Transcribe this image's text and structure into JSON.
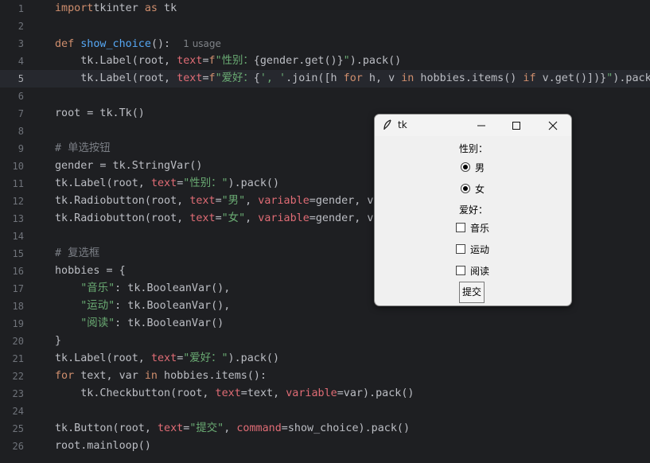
{
  "editor": {
    "current_line": 5,
    "lines": [
      {
        "n": "1",
        "tokens": [
          [
            "kw",
            "import"
          ],
          [
            "",
            "tkinter "
          ],
          [
            "kw",
            "as"
          ],
          [
            "",
            " tk"
          ]
        ]
      },
      {
        "n": "2",
        "tokens": []
      },
      {
        "n": "3",
        "tokens": [
          [
            "kw",
            "def "
          ],
          [
            "fn",
            "show_choice"
          ],
          [
            "",
            "():  "
          ],
          [
            "hint",
            "1 usage"
          ]
        ]
      },
      {
        "n": "4",
        "tokens": [
          [
            "",
            "    tk.Label(root, "
          ],
          [
            "kwa",
            "text"
          ],
          [
            "",
            "="
          ],
          [
            "kw",
            "f"
          ],
          [
            "str",
            "\"性别："
          ],
          [
            "",
            "{gender.get()}"
          ],
          [
            "str",
            "\""
          ],
          [
            "",
            ").pack()"
          ]
        ]
      },
      {
        "n": "5",
        "tokens": [
          [
            "",
            "    tk.Label(root, "
          ],
          [
            "kwa",
            "text"
          ],
          [
            "",
            "="
          ],
          [
            "kw",
            "f"
          ],
          [
            "str",
            "\"爱好："
          ],
          [
            "",
            "{"
          ],
          [
            "str",
            "', '"
          ],
          [
            "",
            ".join([h "
          ],
          [
            "kw",
            "for"
          ],
          [
            "",
            " h, v "
          ],
          [
            "kw",
            "in"
          ],
          [
            "",
            " hobbies.items() "
          ],
          [
            "kw",
            "if"
          ],
          [
            "",
            " v.get()])}"
          ],
          [
            "str",
            "\""
          ],
          [
            "",
            ").pack("
          ]
        ]
      },
      {
        "n": "6",
        "tokens": []
      },
      {
        "n": "7",
        "tokens": [
          [
            "",
            "root = tk.Tk()"
          ]
        ]
      },
      {
        "n": "8",
        "tokens": []
      },
      {
        "n": "9",
        "tokens": [
          [
            "cmt",
            "# 单选按钮"
          ]
        ]
      },
      {
        "n": "10",
        "tokens": [
          [
            "",
            "gender = tk.StringVar()"
          ]
        ]
      },
      {
        "n": "11",
        "tokens": [
          [
            "",
            "tk.Label(root, "
          ],
          [
            "kwa",
            "text"
          ],
          [
            "",
            "="
          ],
          [
            "str",
            "\"性别：\""
          ],
          [
            "",
            ").pack()"
          ]
        ]
      },
      {
        "n": "12",
        "tokens": [
          [
            "",
            "tk.Radiobutton(root, "
          ],
          [
            "kwa",
            "text"
          ],
          [
            "",
            "="
          ],
          [
            "str",
            "\"男\""
          ],
          [
            "",
            ", "
          ],
          [
            "kwa",
            "variable"
          ],
          [
            "",
            "=gender, va"
          ]
        ]
      },
      {
        "n": "13",
        "tokens": [
          [
            "",
            "tk.Radiobutton(root, "
          ],
          [
            "kwa",
            "text"
          ],
          [
            "",
            "="
          ],
          [
            "str",
            "\"女\""
          ],
          [
            "",
            ", "
          ],
          [
            "kwa",
            "variable"
          ],
          [
            "",
            "=gender, va"
          ]
        ]
      },
      {
        "n": "14",
        "tokens": []
      },
      {
        "n": "15",
        "tokens": [
          [
            "cmt",
            "# 复选框"
          ]
        ]
      },
      {
        "n": "16",
        "tokens": [
          [
            "",
            "hobbies = {"
          ]
        ]
      },
      {
        "n": "17",
        "tokens": [
          [
            "",
            "    "
          ],
          [
            "str",
            "\"音乐\""
          ],
          [
            "",
            ": tk.BooleanVar(),"
          ]
        ]
      },
      {
        "n": "18",
        "tokens": [
          [
            "",
            "    "
          ],
          [
            "str",
            "\"运动\""
          ],
          [
            "",
            ": tk.BooleanVar(),"
          ]
        ]
      },
      {
        "n": "19",
        "tokens": [
          [
            "",
            "    "
          ],
          [
            "str",
            "\"阅读\""
          ],
          [
            "",
            ": tk.BooleanVar()"
          ]
        ]
      },
      {
        "n": "20",
        "tokens": [
          [
            "",
            "}"
          ]
        ]
      },
      {
        "n": "21",
        "tokens": [
          [
            "",
            "tk.Label(root, "
          ],
          [
            "kwa",
            "text"
          ],
          [
            "",
            "="
          ],
          [
            "str",
            "\"爱好：\""
          ],
          [
            "",
            ").pack()"
          ]
        ]
      },
      {
        "n": "22",
        "tokens": [
          [
            "kw",
            "for"
          ],
          [
            "",
            " text, var "
          ],
          [
            "kw",
            "in"
          ],
          [
            "",
            " hobbies.items():"
          ]
        ]
      },
      {
        "n": "23",
        "tokens": [
          [
            "",
            "    tk.Checkbutton(root, "
          ],
          [
            "kwa",
            "text"
          ],
          [
            "",
            "=text, "
          ],
          [
            "kwa",
            "variable"
          ],
          [
            "",
            "=var).pack()"
          ]
        ]
      },
      {
        "n": "24",
        "tokens": []
      },
      {
        "n": "25",
        "tokens": [
          [
            "",
            "tk.Button(root, "
          ],
          [
            "kwa",
            "text"
          ],
          [
            "",
            "="
          ],
          [
            "str",
            "\"提交\""
          ],
          [
            "",
            ", "
          ],
          [
            "kwa",
            "command"
          ],
          [
            "",
            "=show_choice).pack()"
          ]
        ]
      },
      {
        "n": "26",
        "tokens": [
          [
            "",
            "root.mainloop()"
          ]
        ]
      }
    ]
  },
  "tk_window": {
    "title": "tk",
    "icon": "feather-icon",
    "gender_label": "性别：",
    "radio_male": {
      "label": "男",
      "selected": true
    },
    "radio_female": {
      "label": "女",
      "selected": true
    },
    "hobby_label": "爱好：",
    "check_music": {
      "label": "音乐",
      "checked": false
    },
    "check_sport": {
      "label": "运动",
      "checked": false
    },
    "check_read": {
      "label": "阅读",
      "checked": false
    },
    "submit_label": "提交"
  }
}
